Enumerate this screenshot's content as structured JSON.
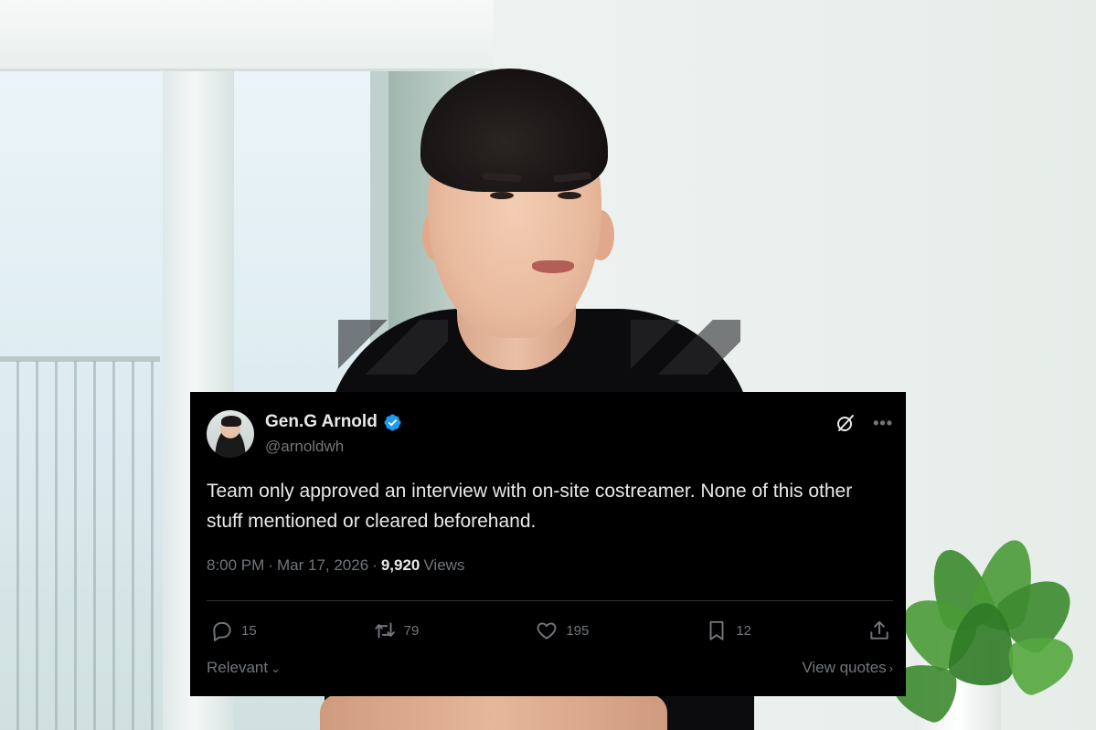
{
  "tweet": {
    "display_name": "Gen.G Arnold",
    "handle": "@arnoldwh",
    "text": "Team only approved an interview with on-site costreamer. None of this other stuff mentioned or cleared beforehand.",
    "time": "8:00 PM",
    "separator": "·",
    "date": "Mar 17, 2026",
    "views_count": "9,920",
    "views_label": "Views",
    "verified": true,
    "verified_color": "#1d9bf0",
    "actions": {
      "replies": "15",
      "reposts": "79",
      "likes": "195",
      "bookmarks": "12"
    },
    "sort_label": "Relevant",
    "view_quotes_label": "View quotes"
  },
  "icons": {
    "avatar": "avatar",
    "verified": "verified-badge-icon",
    "grok": "grok-icon",
    "more": "more-icon",
    "reply": "reply-icon",
    "repost": "repost-icon",
    "like": "like-icon",
    "bookmark": "bookmark-icon",
    "share": "share-icon"
  },
  "colors": {
    "card_bg": "#000000",
    "text_primary": "#e7e9ea",
    "text_secondary": "#71767b",
    "divider": "#2f3336"
  }
}
